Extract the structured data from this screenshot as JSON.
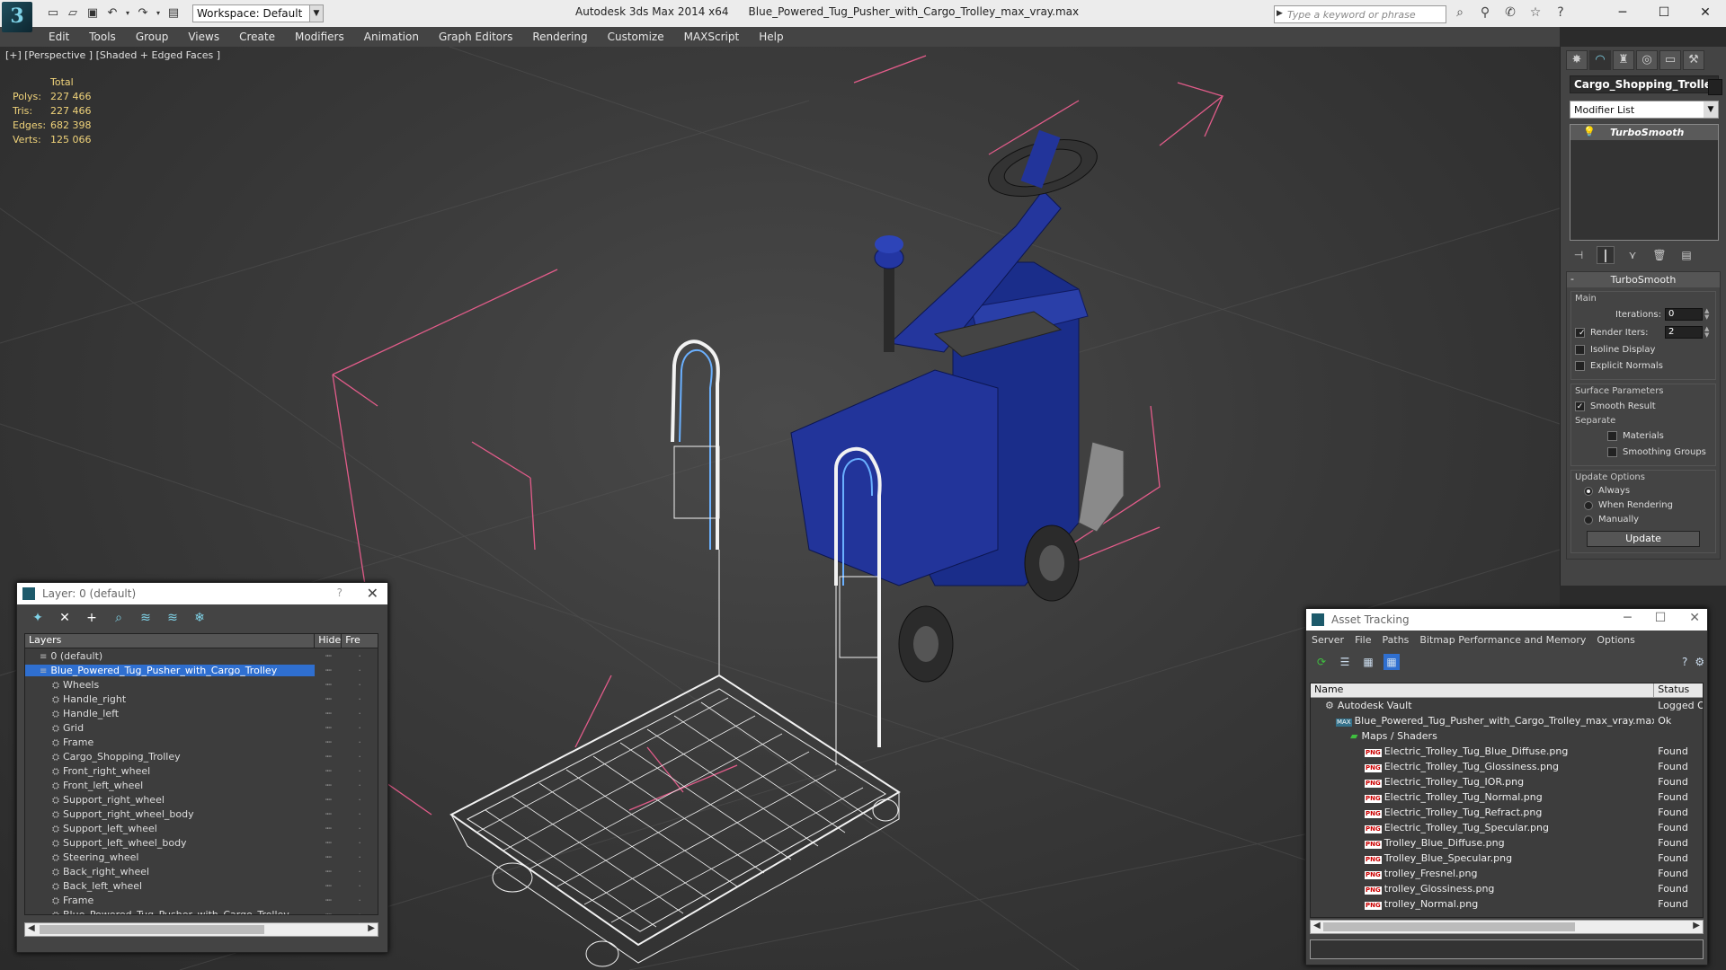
{
  "app": {
    "title": "Autodesk 3ds Max  2014 x64",
    "filename": "Blue_Powered_Tug_Pusher_with_Cargo_Trolley_max_vray.max",
    "workspace": "Workspace: Default",
    "search_placeholder": "Type a keyword or phrase"
  },
  "menu": [
    "Edit",
    "Tools",
    "Group",
    "Views",
    "Create",
    "Modifiers",
    "Animation",
    "Graph Editors",
    "Rendering",
    "Customize",
    "MAXScript",
    "Help"
  ],
  "viewport": {
    "label": "[+] [Perspective ] [Shaded + Edged Faces ]",
    "stats": {
      "header": "Total",
      "rows": [
        {
          "k": "Polys:",
          "v": "227 466"
        },
        {
          "k": "Tris:",
          "v": "227 466"
        },
        {
          "k": "Edges:",
          "v": "682 398"
        },
        {
          "k": "Verts:",
          "v": "125 066"
        }
      ]
    }
  },
  "command_panel": {
    "object_name": "Cargo_Shopping_Trolley",
    "modifier_list": "Modifier List",
    "stack_item": "TurboSmooth",
    "rollout_title": "TurboSmooth",
    "main_label": "Main",
    "iterations_label": "Iterations:",
    "iterations_value": "0",
    "render_iters_label": "Render Iters:",
    "render_iters_value": "2",
    "isoline_label": "Isoline Display",
    "explicit_label": "Explicit Normals",
    "surface_label": "Surface Parameters",
    "smooth_result_label": "Smooth Result",
    "separate_label": "Separate",
    "materials_label": "Materials",
    "smoothing_groups_label": "Smoothing Groups",
    "update_options_label": "Update Options",
    "always_label": "Always",
    "when_rendering_label": "When Rendering",
    "manually_label": "Manually",
    "update_button": "Update"
  },
  "layer_window": {
    "title": "Layer: 0 (default)",
    "help": "?",
    "col_layers": "Layers",
    "col_hide": "Hide",
    "col_freeze": "Fre",
    "rows": [
      {
        "name": "0 (default)",
        "level": 1,
        "type": "layer"
      },
      {
        "name": "Blue_Powered_Tug_Pusher_with_Cargo_Trolley",
        "level": 1,
        "type": "layer",
        "selected": true
      },
      {
        "name": "Wheels",
        "level": 2
      },
      {
        "name": "Handle_right",
        "level": 2
      },
      {
        "name": "Handle_left",
        "level": 2
      },
      {
        "name": "Grid",
        "level": 2
      },
      {
        "name": "Frame",
        "level": 2
      },
      {
        "name": "Cargo_Shopping_Trolley",
        "level": 2
      },
      {
        "name": "Front_right_wheel",
        "level": 2
      },
      {
        "name": "Front_left_wheel",
        "level": 2
      },
      {
        "name": "Support_right_wheel",
        "level": 2
      },
      {
        "name": "Support_right_wheel_body",
        "level": 2
      },
      {
        "name": "Support_left_wheel",
        "level": 2
      },
      {
        "name": "Support_left_wheel_body",
        "level": 2
      },
      {
        "name": "Steering_wheel",
        "level": 2
      },
      {
        "name": "Back_right_wheel",
        "level": 2
      },
      {
        "name": "Back_left_wheel",
        "level": 2
      },
      {
        "name": "Frame",
        "level": 2
      },
      {
        "name": "Blue_Powered_Tug_Pusher_with_Cargo_Trolley",
        "level": 2
      }
    ]
  },
  "asset_window": {
    "title": "Asset Tracking",
    "menu": [
      "Server",
      "File",
      "Paths",
      "Bitmap Performance and Memory",
      "Options"
    ],
    "col_name": "Name",
    "col_status": "Status",
    "rows": [
      {
        "name": "Autodesk Vault",
        "status": "Logged O",
        "kind": "vault",
        "indent": 16
      },
      {
        "name": "Blue_Powered_Tug_Pusher_with_Cargo_Trolley_max_vray.max",
        "status": "Ok",
        "kind": "max",
        "indent": 28
      },
      {
        "name": "Maps / Shaders",
        "status": "",
        "kind": "folder",
        "indent": 44
      },
      {
        "name": "Electric_Trolley_Tug_Blue_Diffuse.png",
        "status": "Found",
        "kind": "png",
        "indent": 60
      },
      {
        "name": "Electric_Trolley_Tug_Glossiness.png",
        "status": "Found",
        "kind": "png",
        "indent": 60
      },
      {
        "name": "Electric_Trolley_Tug_IOR.png",
        "status": "Found",
        "kind": "png",
        "indent": 60
      },
      {
        "name": "Electric_Trolley_Tug_Normal.png",
        "status": "Found",
        "kind": "png",
        "indent": 60
      },
      {
        "name": "Electric_Trolley_Tug_Refract.png",
        "status": "Found",
        "kind": "png",
        "indent": 60
      },
      {
        "name": "Electric_Trolley_Tug_Specular.png",
        "status": "Found",
        "kind": "png",
        "indent": 60
      },
      {
        "name": "Trolley_Blue_Diffuse.png",
        "status": "Found",
        "kind": "png",
        "indent": 60
      },
      {
        "name": "Trolley_Blue_Specular.png",
        "status": "Found",
        "kind": "png",
        "indent": 60
      },
      {
        "name": "trolley_Fresnel.png",
        "status": "Found",
        "kind": "png",
        "indent": 60
      },
      {
        "name": "trolley_Glossiness.png",
        "status": "Found",
        "kind": "png",
        "indent": 60
      },
      {
        "name": "trolley_Normal.png",
        "status": "Found",
        "kind": "png",
        "indent": 60
      }
    ]
  },
  "icons": {
    "png_badge": "PNG",
    "max_badge": "MAX"
  }
}
